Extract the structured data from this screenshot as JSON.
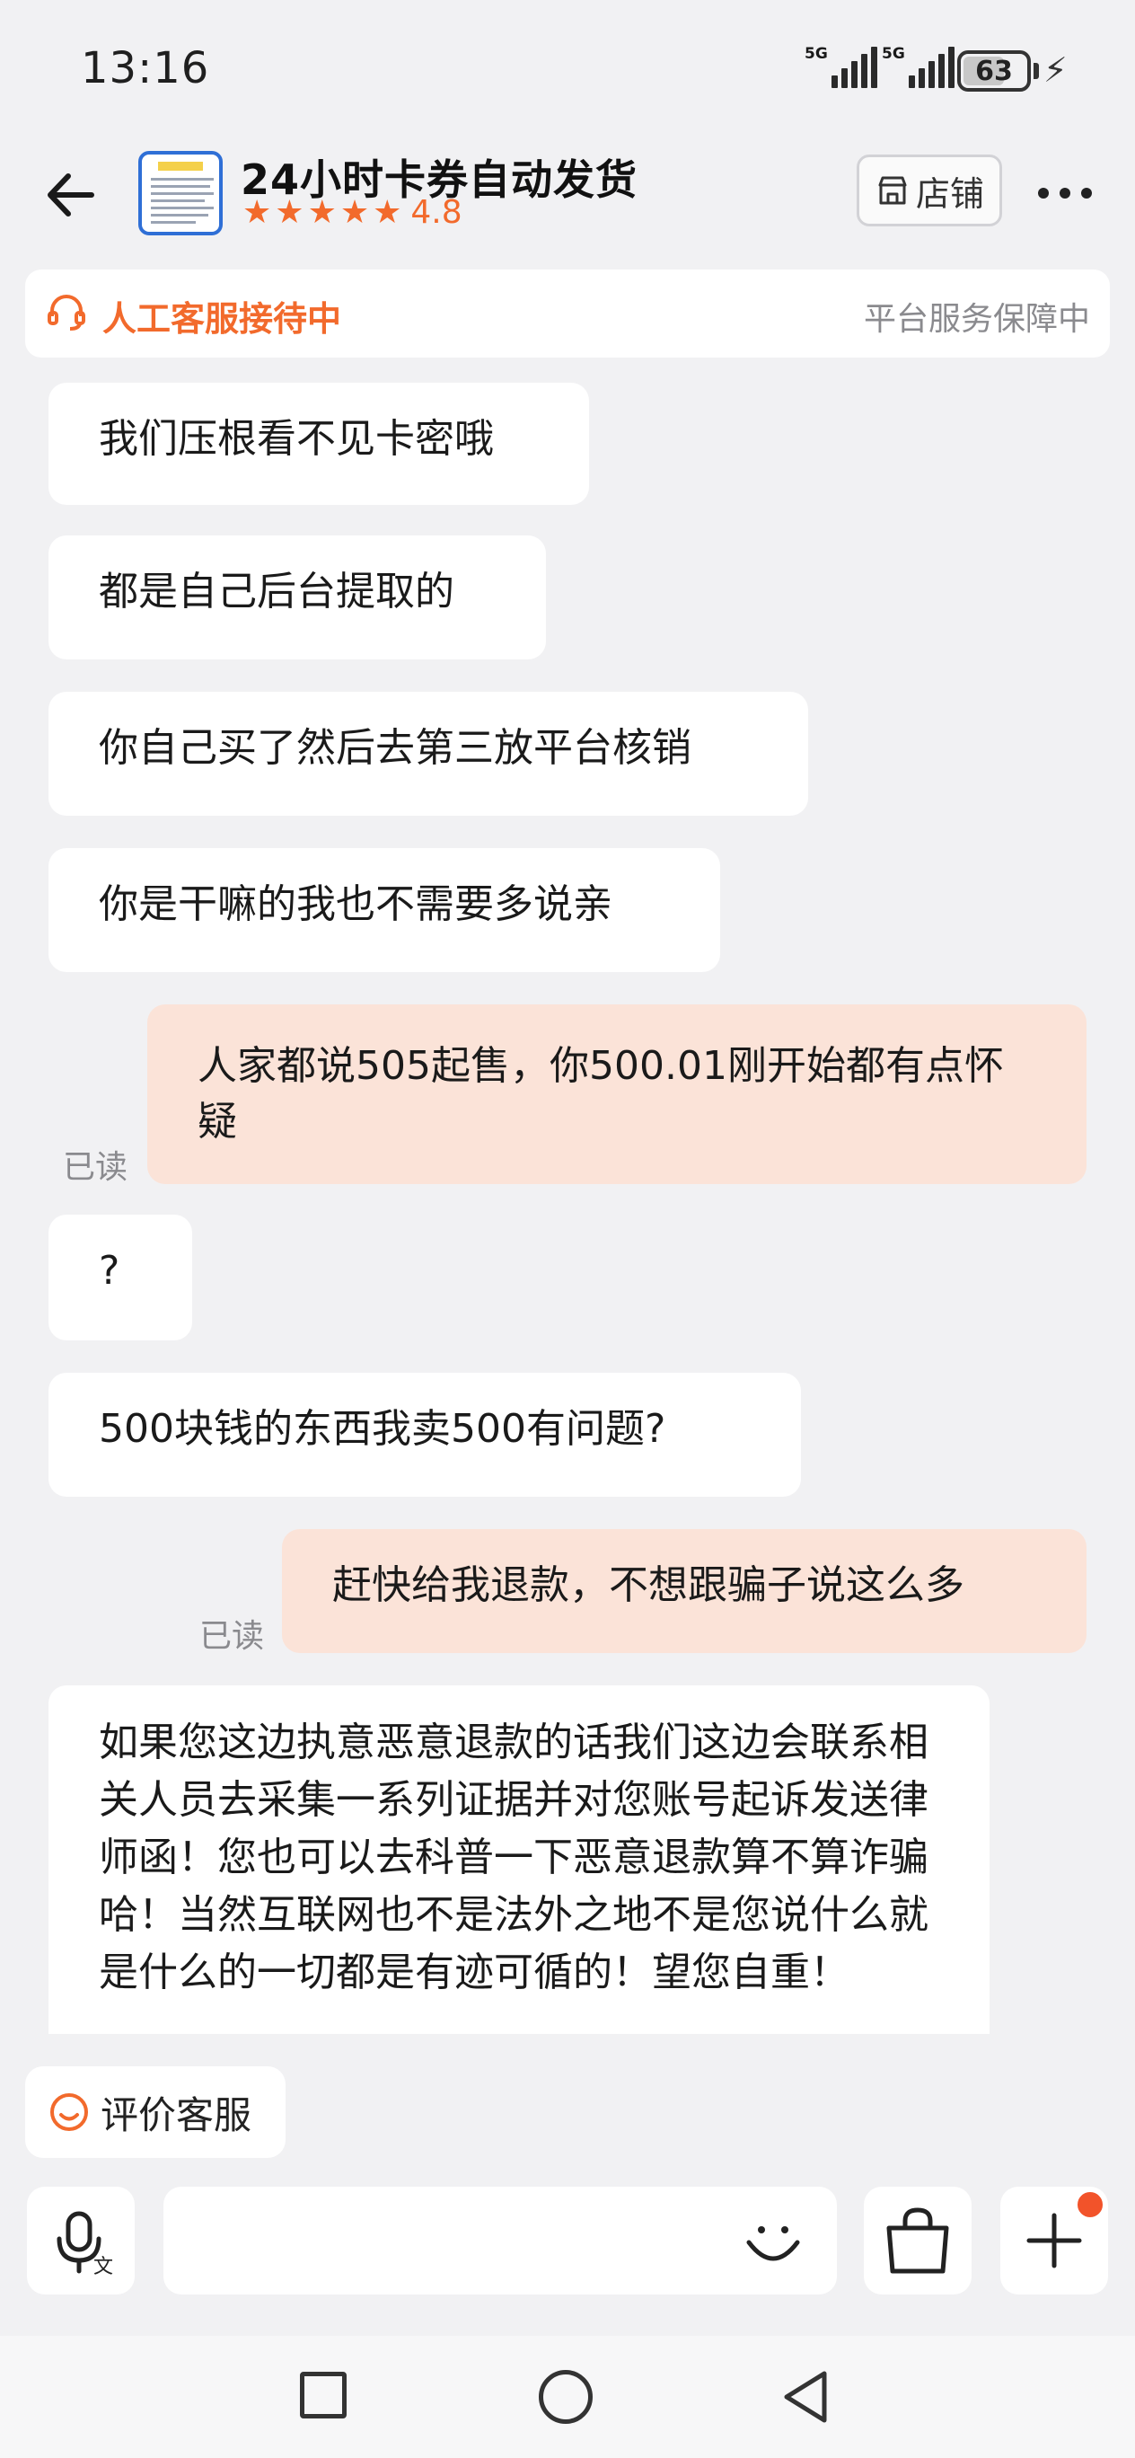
{
  "status_bar": {
    "time": "13:16",
    "network_1": "5G",
    "network_2": "5G",
    "battery": "63"
  },
  "header": {
    "shop_name": "24小时卡券自动发货",
    "rating": "4.8",
    "store_button": "店铺"
  },
  "service_banner": {
    "status": "人工客服接待中",
    "guarantee": "平台服务保障中"
  },
  "messages": [
    {
      "dir": "in",
      "text": "我们压根看不见卡密哦"
    },
    {
      "dir": "in",
      "text": "都是自己后台提取的"
    },
    {
      "dir": "in",
      "text": "你自己买了然后去第三放平台核销"
    },
    {
      "dir": "in",
      "text": "你是干嘛的我也不需要多说亲"
    },
    {
      "dir": "out",
      "text": "人家都说505起售，你500.01刚开始都有点怀疑",
      "read": "已读"
    },
    {
      "dir": "in",
      "text": "?"
    },
    {
      "dir": "in",
      "text": "500块钱的东西我卖500有问题?"
    },
    {
      "dir": "out",
      "text": "赶快给我退款，不想跟骗子说这么多",
      "read": "已读"
    },
    {
      "dir": "in",
      "text": "如果您这边执意恶意退款的话我们这边会联系相关人员去采集一系列证据并对您账号起诉发送律师函！您也可以去科普一下恶意退款算不算诈骗哈！当然互联网也不是法外之地不是您说什么就是什么的一切都是有迹可循的！望您自重！"
    }
  ],
  "rate_button": "评价客服",
  "input": {
    "placeholder": ""
  },
  "colors": {
    "accent": "#f26a2c",
    "out_bubble": "#fbe3d8",
    "background": "#f1f1f3"
  }
}
